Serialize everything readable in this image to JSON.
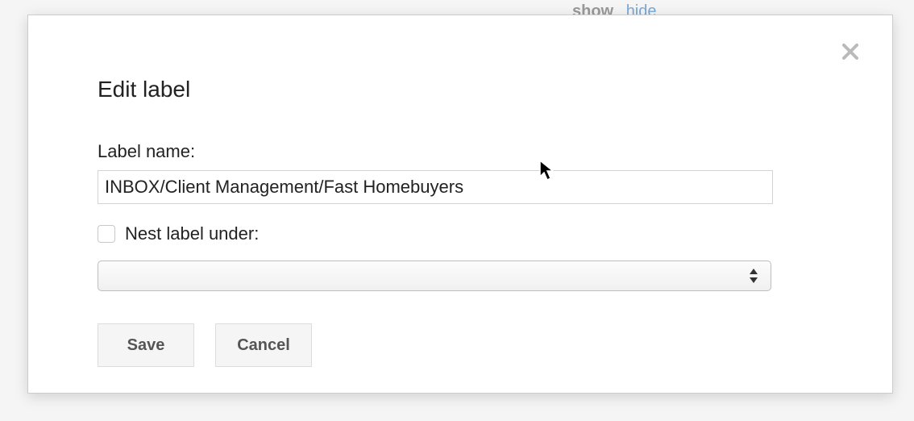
{
  "background": {
    "show_label": "show",
    "hide_label": "hide"
  },
  "dialog": {
    "title": "Edit label",
    "label_name_label": "Label name:",
    "label_name_value": "INBOX/Client Management/Fast Homebuyers",
    "nest_checkbox_label": "Nest label under:",
    "nest_checked": false,
    "nest_select_value": "",
    "save_label": "Save",
    "cancel_label": "Cancel"
  }
}
